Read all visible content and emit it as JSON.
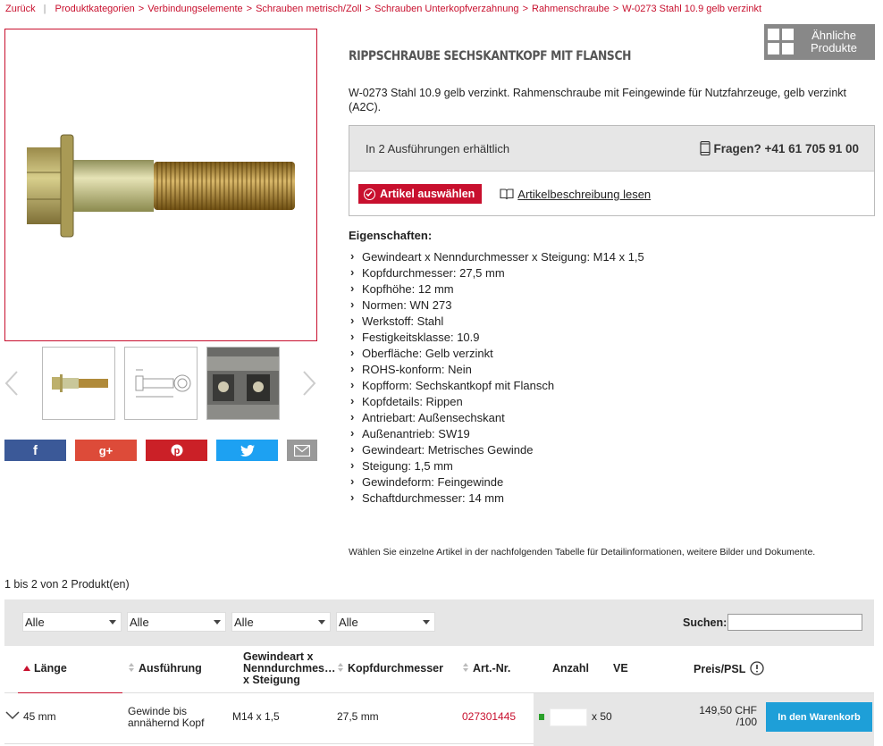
{
  "breadcrumb": {
    "back": "Zurück",
    "items": [
      "Produktkategorien",
      "Verbindungselemente",
      "Schrauben metrisch/Zoll",
      "Schrauben Unterkopfverzahnung",
      "Rahmenschraube",
      "W-0273 Stahl 10.9 gelb verzinkt"
    ],
    "separator": ">"
  },
  "similar_button": {
    "label_line1": "Ähnliche",
    "label_line2": "Produkte",
    "icon": "grid-icon"
  },
  "product": {
    "title": "RIPPSCHRAUBE SECHSKANTKOPF MIT FLANSCH",
    "description": "W-0273 Stahl 10.9 gelb verzinkt. Rahmenschraube mit Feingewinde für Nutzfahrzeuge, gelb verzinkt (A2C).",
    "image_alt_icon": "bolt-image"
  },
  "variants": {
    "availability": "In 2 Ausführungen erhältlich",
    "phone": "Fragen? +41 61 705 91 00",
    "select_label": "Artikel auswählen",
    "read_description": "Artikelbeschreibung lesen"
  },
  "properties": {
    "title": "Eigenschaften:",
    "items": [
      "Gewindeart x Nenndurchmesser x Steigung: M14 x 1,5",
      "Kopfdurchmesser: 27,5 mm",
      "Kopfhöhe: 12 mm",
      "Normen: WN 273",
      "Werkstoff: Stahl",
      "Festigkeitsklasse: 10.9",
      "Oberfläche: Gelb verzinkt",
      "ROHS-konform: Nein",
      "Kopfform: Sechskantkopf mit Flansch",
      "Kopfdetails: Rippen",
      "Antriebart: Außensechskant",
      "Außenantrieb: SW19",
      "Gewindeart: Metrisches Gewinde",
      "Steigung: 1,5 mm",
      "Gewindeform: Feingewinde",
      "Schaftdurchmesser: 14 mm"
    ]
  },
  "social": [
    "facebook-icon",
    "google-plus-icon",
    "pinterest-icon",
    "twitter-icon",
    "mail-icon"
  ],
  "social_labels": {
    "facebook": "f",
    "google": "g+"
  },
  "colors": {
    "accent": "#c8102e",
    "cart": "#1e9fd8",
    "facebook": "#3b5998",
    "google": "#dd4b39",
    "pinterest": "#cb2027",
    "twitter": "#1da1f2",
    "mail": "#999999"
  },
  "table_hint": "Wählen Sie einzelne Artikel in der nachfolgenden Tabelle für Detailinformationen, weitere Bilder und Dokumente.",
  "count_text": "1 bis 2 von 2 Produkt(en)",
  "filters": {
    "options": [
      "Alle",
      "Alle",
      "Alle",
      "Alle"
    ],
    "search_label": "Suchen:",
    "search_value": ""
  },
  "table": {
    "headers": {
      "laenge": "Länge",
      "ausfuehrung": "Ausführung",
      "gewinde_l1": "Gewindeart x",
      "gewinde_l2": "Nenndurchmes…",
      "gewinde_l3": "x Steigung",
      "kopf": "Kopfdurchmesser",
      "artnr": "Art.-Nr.",
      "anzahl": "Anzahl",
      "ve": "VE",
      "preis": "Preis/PSL"
    },
    "rows": [
      {
        "laenge": "45 mm",
        "ausfuehrung_l1": "Gewinde bis",
        "ausfuehrung_l2": "annähernd Kopf",
        "gewinde": "M14 x 1,5",
        "kopf": "27,5 mm",
        "artnr": "027301445",
        "anzahl": "",
        "ve": "x 50",
        "preis_l1": "149,50 CHF",
        "preis_l2": "/100",
        "cart_label": "In den Warenkorb"
      }
    ]
  }
}
